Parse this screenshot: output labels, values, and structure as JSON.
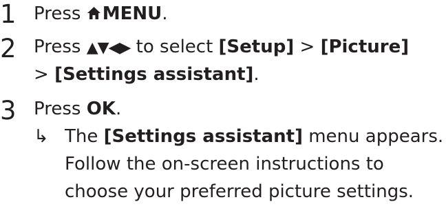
{
  "steps": [
    {
      "number": "1",
      "press": "Press",
      "key": "MENU",
      "end": "."
    },
    {
      "number": "2",
      "press": "Press",
      "arrows": "▲▼◀▶",
      "mid": "to select",
      "path1": "[Setup]",
      "sep1": ">",
      "path2": "[Picture]",
      "sep2": ">",
      "path3": "[Settings assistant]",
      "end": "."
    },
    {
      "number": "3",
      "press": "Press",
      "key": "OK",
      "end": ".",
      "result": {
        "arrow": "↳",
        "the": "The",
        "menu_name": "[Settings assistant]",
        "rest1": "menu appears.",
        "line2": "Follow the on-screen instructions to",
        "line3": "choose your preferred picture settings."
      }
    }
  ],
  "icons": {
    "home": "home-icon"
  },
  "colors": {
    "text": "#231f20"
  }
}
